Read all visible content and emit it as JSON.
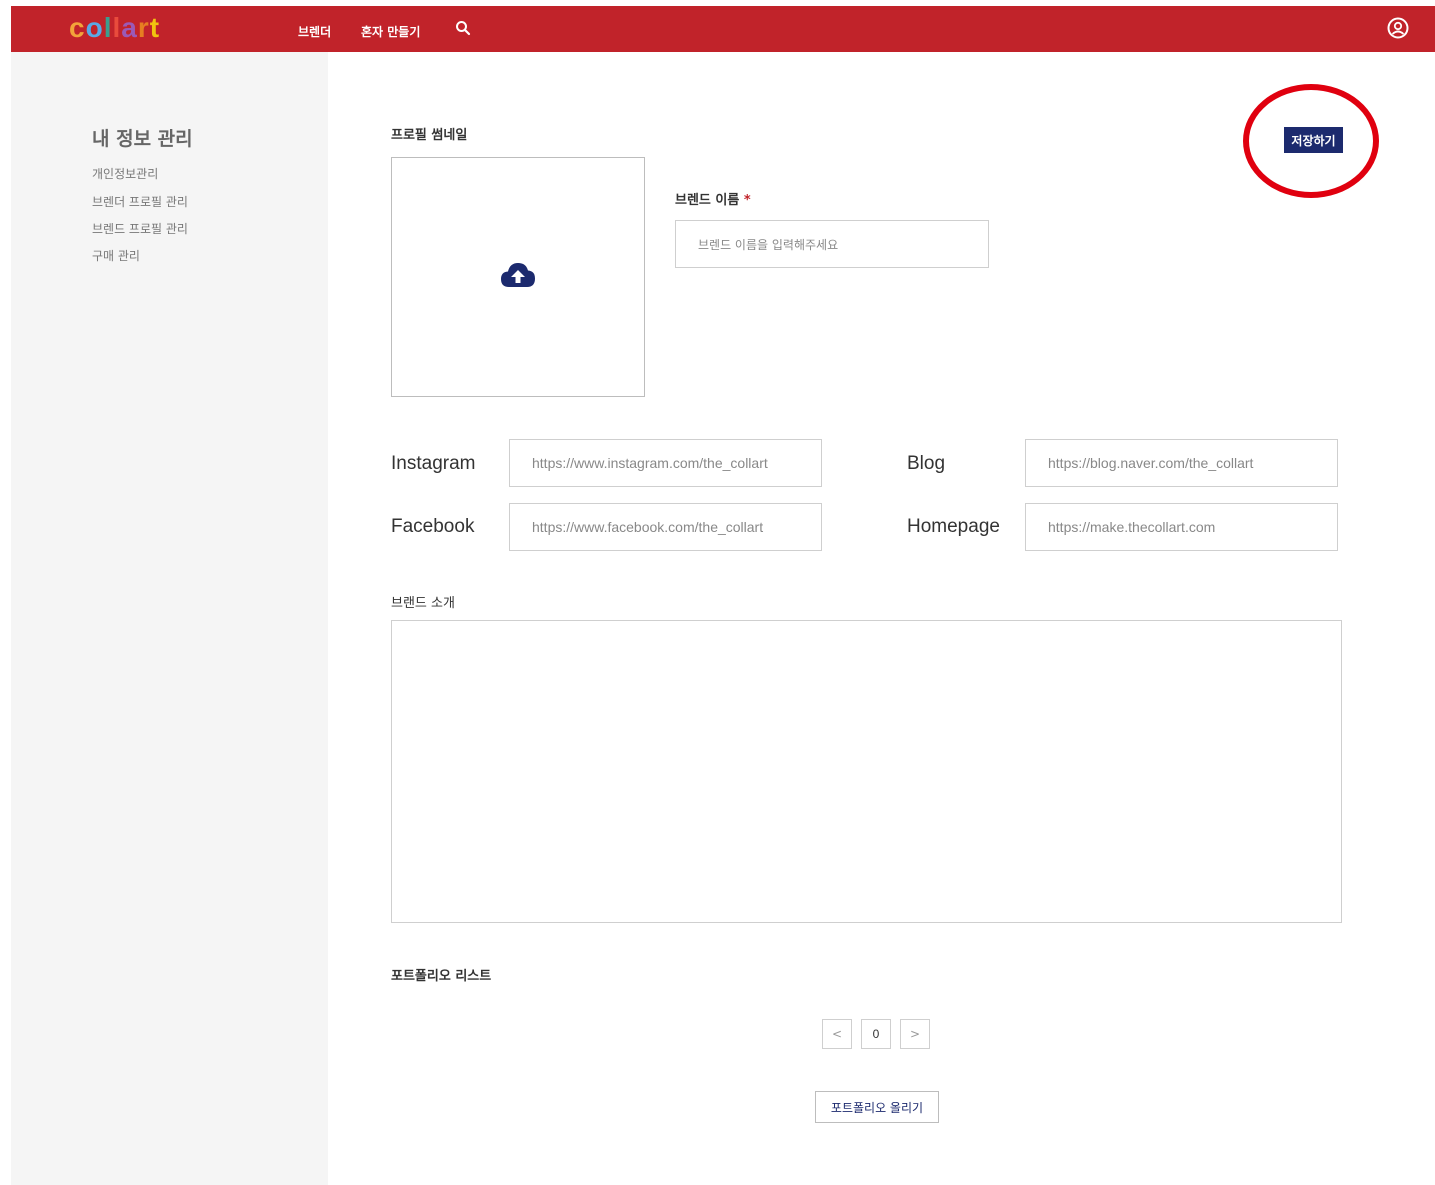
{
  "header": {
    "logo_text": "collart",
    "nav": [
      "브렌더",
      "혼자 만들기"
    ],
    "search_icon": "search-icon",
    "user_icon": "user-circle-icon",
    "bg_color": "#c1232a"
  },
  "sidebar": {
    "title": "내 정보 관리",
    "items": [
      "개인정보관리",
      "브렌더 프로필 관리",
      "브렌드 프로필 관리",
      "구매 관리"
    ]
  },
  "main": {
    "thumbnail_label": "프로필 썸네일",
    "upload_icon": "cloud-upload-icon",
    "brand_name_label": "브렌드 이름",
    "required_mark": "*",
    "brand_name_placeholder": "브렌드 이름을 입력해주세요",
    "save_label": "저장하기",
    "social": {
      "instagram_label": "Instagram",
      "instagram_placeholder": "https://www.instagram.com/the_collart",
      "blog_label": "Blog",
      "blog_placeholder": "https://blog.naver.com/the_collart",
      "facebook_label": "Facebook",
      "facebook_placeholder": "https://www.facebook.com/the_collart",
      "homepage_label": "Homepage",
      "homepage_placeholder": "https://make.thecollart.com"
    },
    "intro_label": "브랜드 소개",
    "portfolio_label": "포트폴리오 리스트",
    "pager": {
      "prev": "<",
      "page": "0",
      "next": ">"
    },
    "upload_portfolio_label": "포트폴리오 올리기"
  },
  "colors": {
    "accent": "#1c2a6e",
    "highlight": "#e0000f"
  }
}
